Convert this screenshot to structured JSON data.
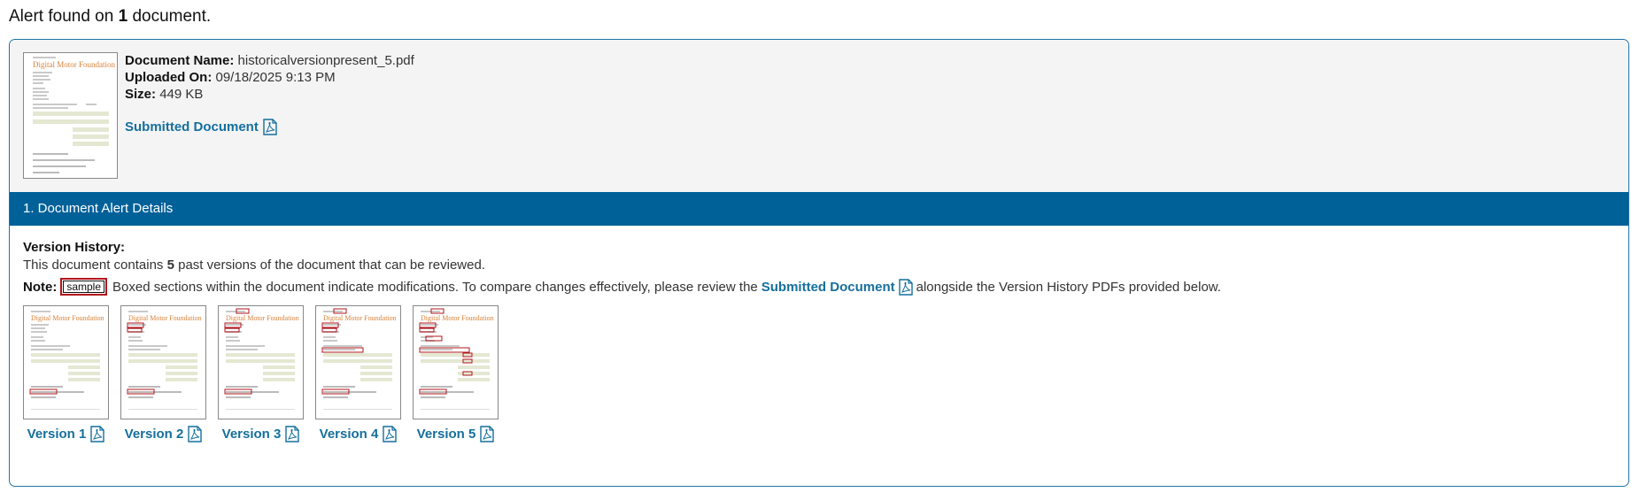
{
  "header": {
    "prefix": "Alert found on",
    "count": "1",
    "suffix": "document."
  },
  "document": {
    "name_label": "Document Name:",
    "name_value": "historicalversionpresent_5.pdf",
    "uploaded_label": "Uploaded On:",
    "uploaded_value": "09/18/2025 9:13 PM",
    "size_label": "Size:",
    "size_value": "449 KB",
    "submitted_link": "Submitted Document"
  },
  "thumbnail_doc": {
    "company": "Digital Motor Foundation"
  },
  "alert_section": {
    "title": "1. Document Alert Details",
    "version_history_label": "Version History:",
    "contains_prefix": "This document contains",
    "contains_count": "5",
    "contains_suffix": "past versions of the document that can be reviewed.",
    "note_label": "Note:",
    "sample_label": "sample",
    "note_text_1": "Boxed sections within the document indicate modifications. To compare changes effectively, please review the",
    "note_link": "Submitted Document",
    "note_text_2": "alongside the Version History PDFs provided below."
  },
  "versions": [
    {
      "label": "Version 1"
    },
    {
      "label": "Version 2"
    },
    {
      "label": "Version 3"
    },
    {
      "label": "Version 4"
    },
    {
      "label": "Version 5"
    }
  ],
  "colors": {
    "accent": "#006199",
    "link": "#156f9c",
    "highlight_box": "#b3141c",
    "thumb_title": "#d9823a"
  },
  "icons": {
    "pdf": "pdf-file-icon"
  }
}
